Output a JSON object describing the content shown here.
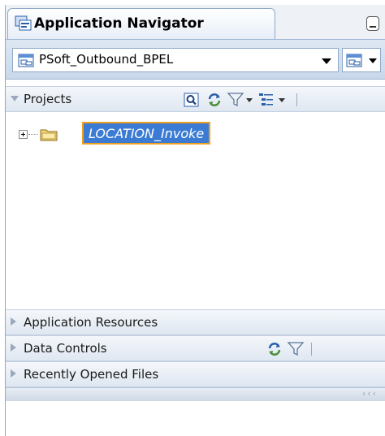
{
  "window": {
    "tab_title": "Application Navigator"
  },
  "app_selector": {
    "selected": "PSoft_Outbound_BPEL"
  },
  "projects": {
    "label": "Projects",
    "tree": [
      {
        "label": "LOCATION_Invoke",
        "selected": true,
        "expanded": false
      }
    ]
  },
  "sections": [
    {
      "label": "Application Resources"
    },
    {
      "label": "Data Controls"
    },
    {
      "label": "Recently Opened Files"
    }
  ],
  "footer": {
    "scroll_glyph": "‹‹‹"
  },
  "colors": {
    "selection_bg": "#3b7bd4",
    "selection_border": "#f0a020",
    "header_bg": "#dfe7f1"
  },
  "icons": [
    "app-navigator-icon",
    "minimize-icon",
    "application-icon",
    "search-icon",
    "refresh-icon",
    "filter-icon",
    "tree-options-icon",
    "folder-icon"
  ]
}
